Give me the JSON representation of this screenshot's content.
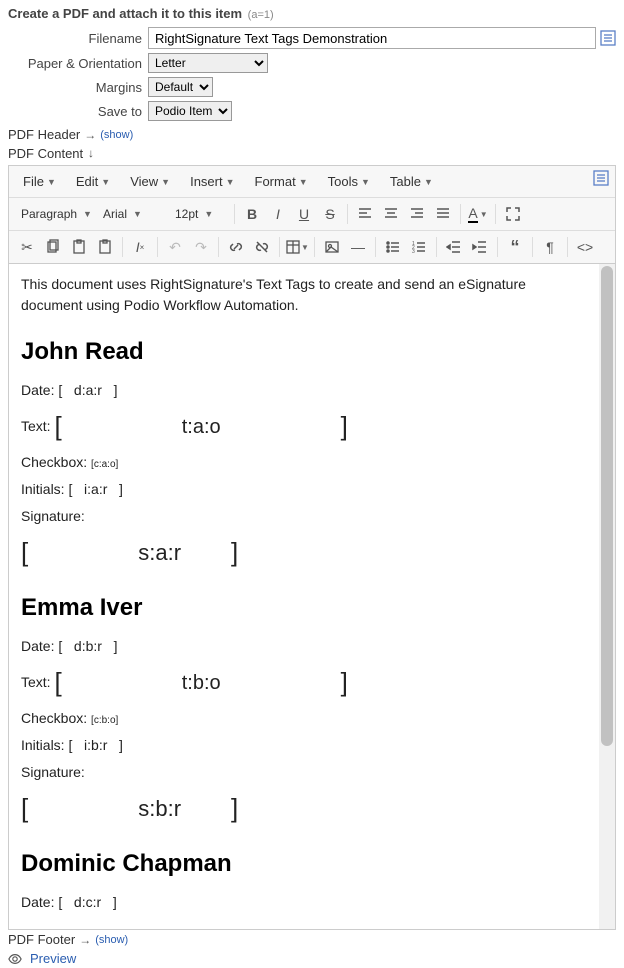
{
  "header": {
    "title": "Create a PDF and attach it to this item",
    "meta": "(a=1)"
  },
  "fields": {
    "filename": {
      "label": "Filename",
      "value": "RightSignature Text Tags Demonstration"
    },
    "paper": {
      "label": "Paper & Orientation",
      "value": "Letter"
    },
    "margins": {
      "label": "Margins",
      "value": "Default"
    },
    "saveto": {
      "label": "Save to",
      "value": "Podio Item"
    }
  },
  "sections": {
    "pdf_header": "PDF Header",
    "pdf_content": "PDF Content",
    "pdf_footer": "PDF Footer",
    "show": "(show)",
    "preview": "Preview"
  },
  "menus": {
    "file": "File",
    "edit": "Edit",
    "view": "View",
    "insert": "Insert",
    "format": "Format",
    "tools": "Tools",
    "table": "Table"
  },
  "toolbar2": {
    "paragraph": "Paragraph",
    "font": "Arial",
    "size": "12pt"
  },
  "doc": {
    "intro": "This document uses RightSignature's Text Tags to create and send an eSignature document using Podio Workflow Automation.",
    "s1": {
      "name": "John Read",
      "date_label": "Date:",
      "date_tag": "d:a:r",
      "text_label": "Text:",
      "text_tag": "t:a:o",
      "cb_label": "Checkbox:",
      "cb_tag": "[c:a:o]",
      "init_label": "Initials:",
      "init_tag": "i:a:r",
      "sig_label": "Signature:",
      "sig_tag": "s:a:r"
    },
    "s2": {
      "name": "Emma Iver",
      "date_label": "Date:",
      "date_tag": "d:b:r",
      "text_label": "Text:",
      "text_tag": "t:b:o",
      "cb_label": "Checkbox:",
      "cb_tag": "[c:b:o]",
      "init_label": "Initials:",
      "init_tag": "i:b:r",
      "sig_label": "Signature:",
      "sig_tag": "s:b:r"
    },
    "s3": {
      "name": "Dominic Chapman",
      "date_label": "Date:",
      "date_tag": "d:c:r"
    }
  }
}
